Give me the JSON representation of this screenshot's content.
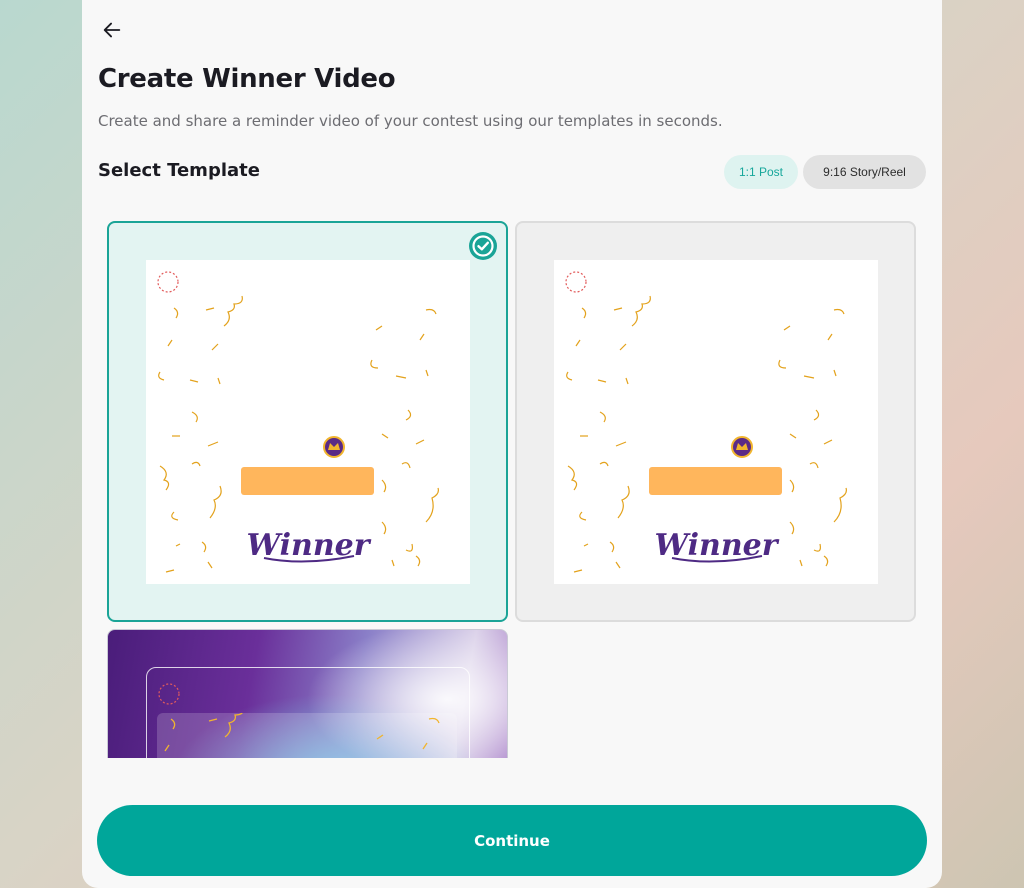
{
  "header": {
    "back_icon": "arrow-left-icon",
    "title": "Create Winner Video",
    "subtitle": "Create and share a reminder video of your contest using our templates in seconds."
  },
  "section": {
    "title": "Select Template",
    "ratio_options": [
      {
        "label": "1:1 Post",
        "selected": true
      },
      {
        "label": "9:16 Story/Reel",
        "selected": false
      }
    ]
  },
  "templates": [
    {
      "style": "white-confetti",
      "selected": true,
      "badge_icon": "check-circle-icon",
      "logo_text": "Winner"
    },
    {
      "style": "white-confetti",
      "selected": false,
      "logo_text": "Winner"
    },
    {
      "style": "purple-gradient",
      "selected": false
    }
  ],
  "colors": {
    "accent": "#00a69a",
    "selected_card_bg": "#e3f4f2",
    "name_bar": "#ffb65c",
    "logo_purple": "#4e2a84",
    "confetti_gold": "#f0b429"
  },
  "footer": {
    "continue_label": "Continue"
  }
}
